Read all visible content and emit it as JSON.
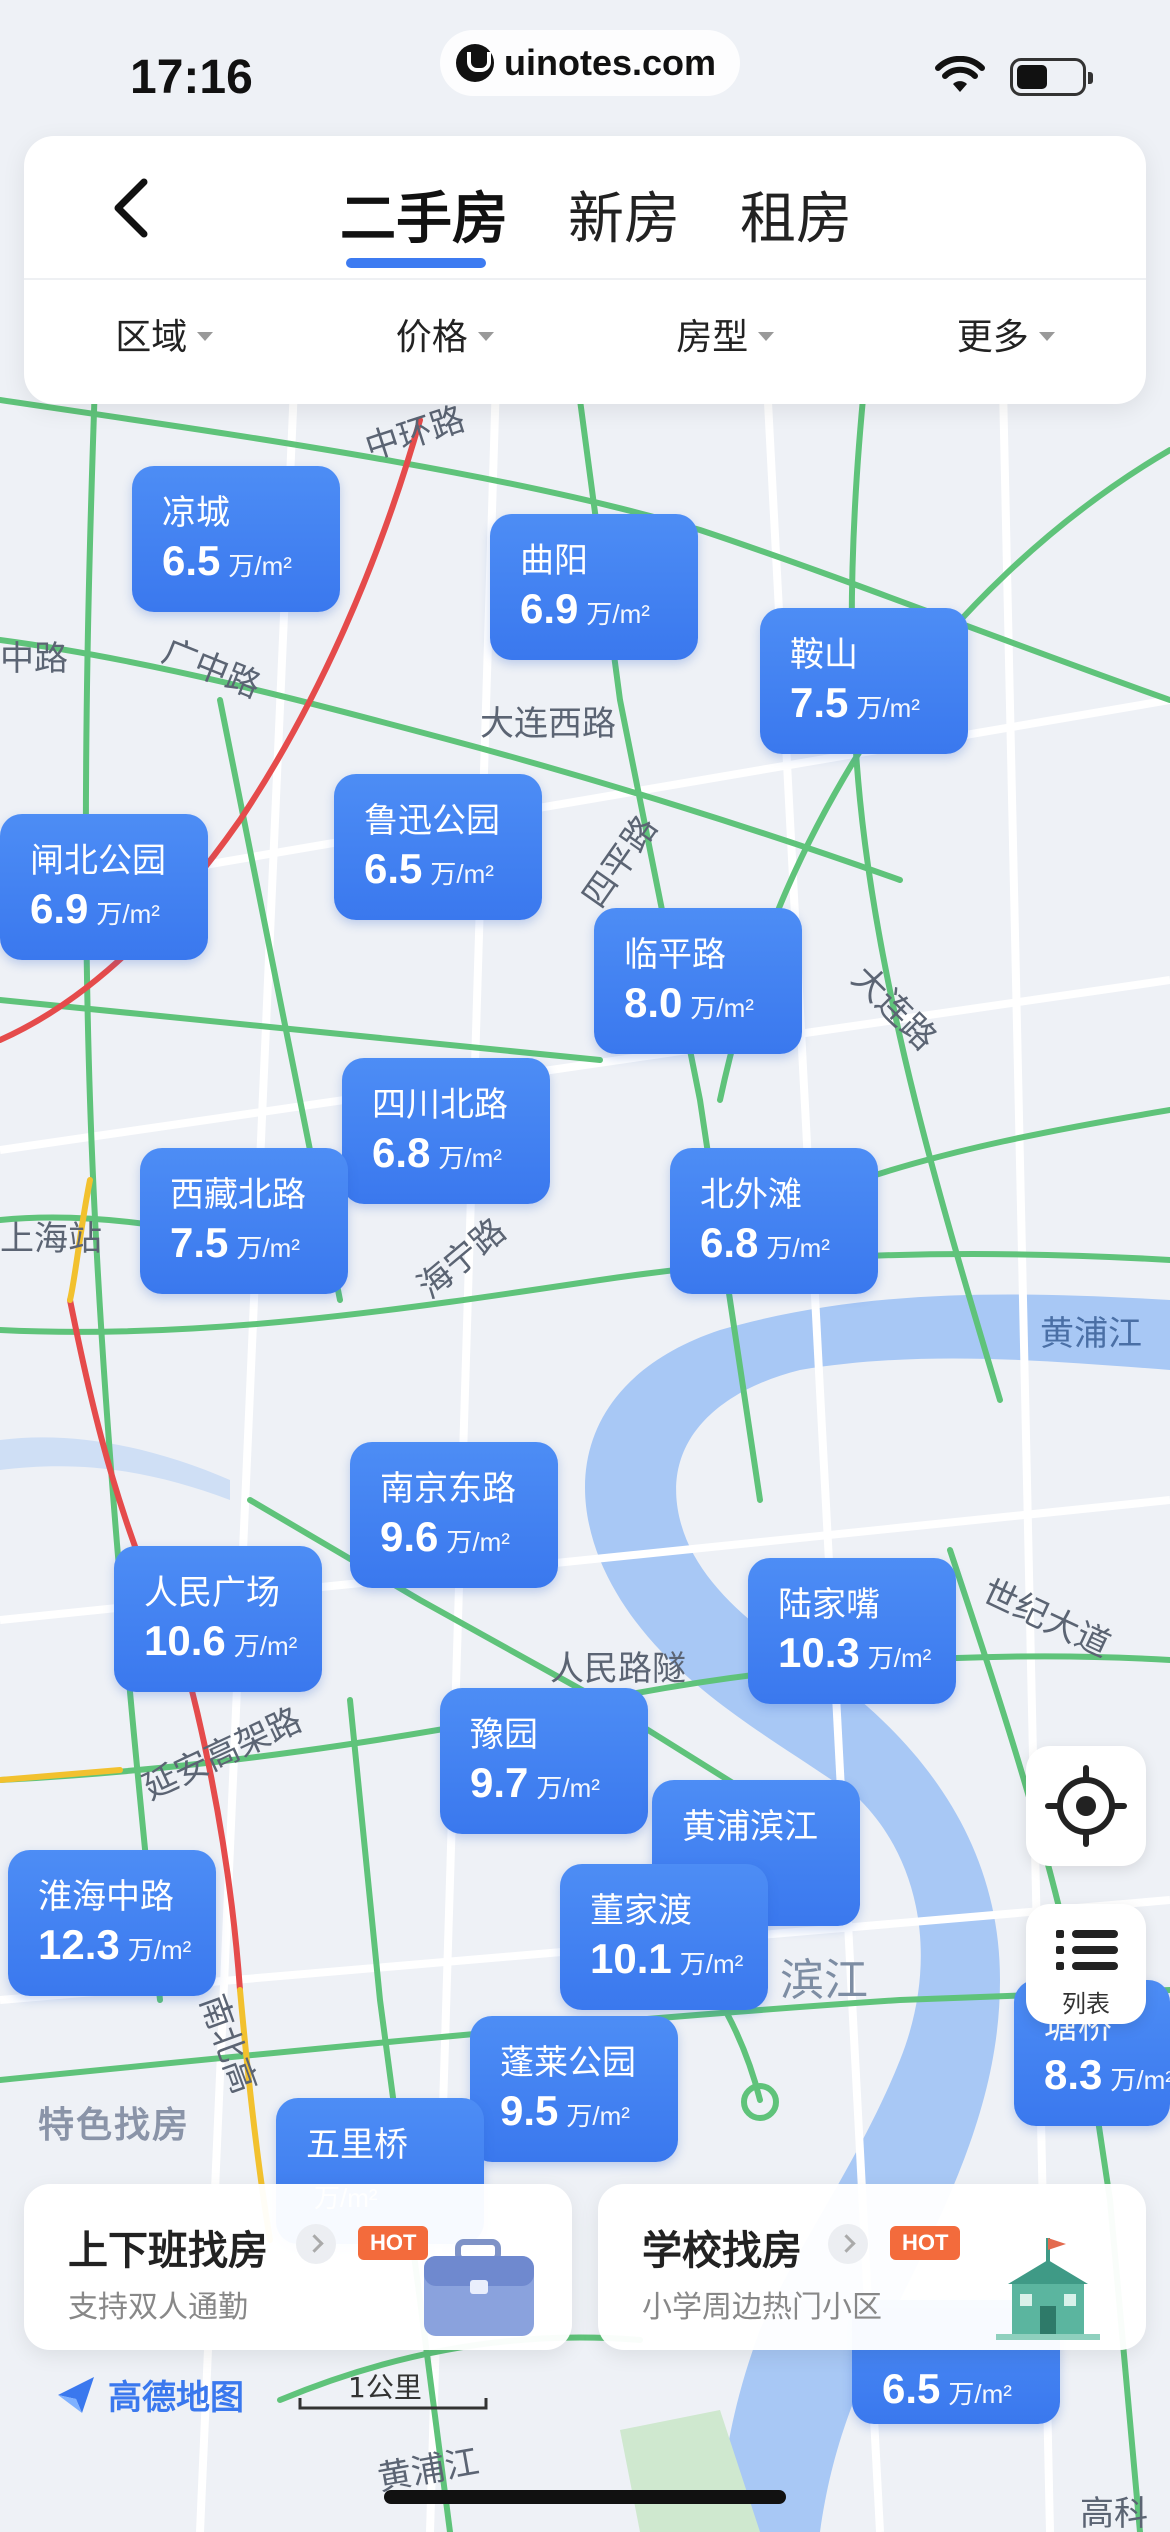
{
  "status": {
    "time": "17:16",
    "url": "uinotes.com"
  },
  "nav": {
    "tabs": [
      {
        "label": "二手房",
        "active": true
      },
      {
        "label": "新房",
        "active": false
      },
      {
        "label": "租房",
        "active": false
      }
    ],
    "filters": [
      "区域",
      "价格",
      "房型",
      "更多"
    ]
  },
  "unit": "万/m²",
  "markers": [
    {
      "name": "凉城",
      "price": "6.5"
    },
    {
      "name": "曲阳",
      "price": "6.9"
    },
    {
      "name": "鞍山",
      "price": "7.5"
    },
    {
      "name": "鲁迅公园",
      "price": "6.5"
    },
    {
      "name": "闸北公园",
      "price": "6.9"
    },
    {
      "name": "临平路",
      "price": "8.0"
    },
    {
      "name": "四川北路",
      "price": "6.8"
    },
    {
      "name": "西藏北路",
      "price": "7.5"
    },
    {
      "name": "北外滩",
      "price": "6.8"
    },
    {
      "name": "南京东路",
      "price": "9.6"
    },
    {
      "name": "人民广场",
      "price": "10.6"
    },
    {
      "name": "陆家嘴",
      "price": "10.3"
    },
    {
      "name": "豫园",
      "price": "9.7"
    },
    {
      "name": "黄浦滨江",
      "price": ""
    },
    {
      "name": "淮海中路",
      "price": "12.3"
    },
    {
      "name": "董家渡",
      "price": "10.1"
    },
    {
      "name": "蓬莱公园",
      "price": "9.5"
    },
    {
      "name": "塘桥",
      "price": "8.3"
    },
    {
      "name": "五里桥",
      "price": ""
    },
    {
      "name": "",
      "price": "6.5"
    }
  ],
  "map_labels": {
    "zhonghuanlu": "中环路",
    "guangzhonglu": "广中路",
    "zhonglu": "中路",
    "dalianxilu": "大连西路",
    "sipinglu": "四平路",
    "dalianlu": "大连路",
    "haininglu": "海宁路",
    "shanghaizhan": "上海站",
    "huangpujiang": "黄浦江",
    "shijidadao": "世纪大道",
    "renminlusui": "人民路隧",
    "yananlu": "延安高架路",
    "binjiang": "滨江",
    "nanbeilu": "南北高",
    "huangpujiang2": "黄浦江",
    "gaokelu": "高科"
  },
  "controls": {
    "list_label": "列表"
  },
  "feature_title": "特色找房",
  "feature_cards": [
    {
      "title": "上下班找房",
      "badge": "HOT",
      "subtitle": "支持双人通勤"
    },
    {
      "title": "学校找房",
      "badge": "HOT",
      "subtitle": "小学周边热门小区"
    }
  ],
  "footer": {
    "brand": "高德地图",
    "scale": "1公里"
  },
  "colors": {
    "accent": "#3a78ee",
    "hot": "#f36b3c",
    "river": "#a8c8f5",
    "road_green": "#5fc37a",
    "road_red": "#e54b4b",
    "road_yellow": "#f2c12e"
  }
}
